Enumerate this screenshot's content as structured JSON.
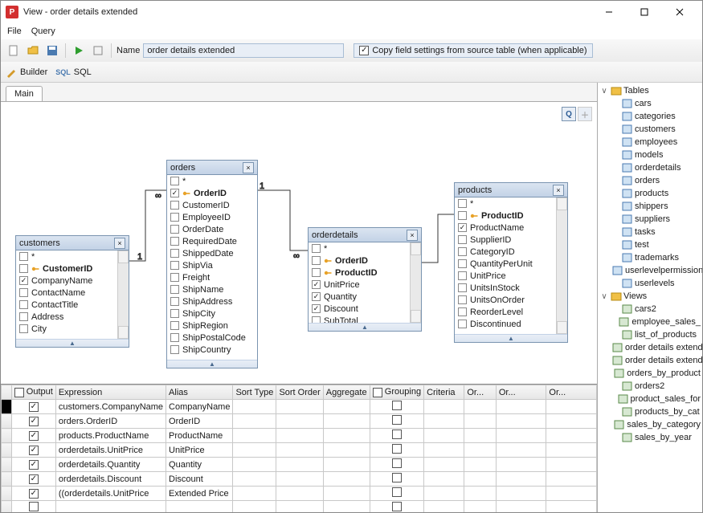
{
  "window": {
    "title": "View - order details extended"
  },
  "menu": {
    "file": "File",
    "query": "Query"
  },
  "toolbar": {
    "name_label": "Name",
    "name_value": "order details extended",
    "copy_label": "Copy field settings from source table (when applicable)"
  },
  "modes": {
    "builder": "Builder",
    "sql": "SQL"
  },
  "tab": {
    "main": "Main"
  },
  "canvas": {
    "customers": {
      "title": "customers",
      "fields": [
        {
          "n": "*",
          "c": false,
          "k": false,
          "b": false
        },
        {
          "n": "CustomerID",
          "c": false,
          "k": true,
          "b": true
        },
        {
          "n": "CompanyName",
          "c": true,
          "k": false,
          "b": false
        },
        {
          "n": "ContactName",
          "c": false,
          "k": false,
          "b": false
        },
        {
          "n": "ContactTitle",
          "c": false,
          "k": false,
          "b": false
        },
        {
          "n": "Address",
          "c": false,
          "k": false,
          "b": false
        },
        {
          "n": "City",
          "c": false,
          "k": false,
          "b": false
        }
      ]
    },
    "orders": {
      "title": "orders",
      "fields": [
        {
          "n": "*",
          "c": false,
          "k": false,
          "b": false
        },
        {
          "n": "OrderID",
          "c": true,
          "k": true,
          "b": true
        },
        {
          "n": "CustomerID",
          "c": false,
          "k": false,
          "b": false
        },
        {
          "n": "EmployeeID",
          "c": false,
          "k": false,
          "b": false
        },
        {
          "n": "OrderDate",
          "c": false,
          "k": false,
          "b": false
        },
        {
          "n": "RequiredDate",
          "c": false,
          "k": false,
          "b": false
        },
        {
          "n": "ShippedDate",
          "c": false,
          "k": false,
          "b": false
        },
        {
          "n": "ShipVia",
          "c": false,
          "k": false,
          "b": false
        },
        {
          "n": "Freight",
          "c": false,
          "k": false,
          "b": false
        },
        {
          "n": "ShipName",
          "c": false,
          "k": false,
          "b": false
        },
        {
          "n": "ShipAddress",
          "c": false,
          "k": false,
          "b": false
        },
        {
          "n": "ShipCity",
          "c": false,
          "k": false,
          "b": false
        },
        {
          "n": "ShipRegion",
          "c": false,
          "k": false,
          "b": false
        },
        {
          "n": "ShipPostalCode",
          "c": false,
          "k": false,
          "b": false
        },
        {
          "n": "ShipCountry",
          "c": false,
          "k": false,
          "b": false
        }
      ]
    },
    "orderdetails": {
      "title": "orderdetails",
      "fields": [
        {
          "n": "*",
          "c": false,
          "k": false,
          "b": false
        },
        {
          "n": "OrderID",
          "c": false,
          "k": true,
          "b": true
        },
        {
          "n": "ProductID",
          "c": false,
          "k": true,
          "b": true
        },
        {
          "n": "UnitPrice",
          "c": true,
          "k": false,
          "b": false
        },
        {
          "n": "Quantity",
          "c": true,
          "k": false,
          "b": false
        },
        {
          "n": "Discount",
          "c": true,
          "k": false,
          "b": false
        },
        {
          "n": "SubTotal",
          "c": false,
          "k": false,
          "b": false
        }
      ]
    },
    "products": {
      "title": "products",
      "fields": [
        {
          "n": "*",
          "c": false,
          "k": false,
          "b": false
        },
        {
          "n": "ProductID",
          "c": false,
          "k": true,
          "b": true
        },
        {
          "n": "ProductName",
          "c": true,
          "k": false,
          "b": false
        },
        {
          "n": "SupplierID",
          "c": false,
          "k": false,
          "b": false
        },
        {
          "n": "CategoryID",
          "c": false,
          "k": false,
          "b": false
        },
        {
          "n": "QuantityPerUnit",
          "c": false,
          "k": false,
          "b": false
        },
        {
          "n": "UnitPrice",
          "c": false,
          "k": false,
          "b": false
        },
        {
          "n": "UnitsInStock",
          "c": false,
          "k": false,
          "b": false
        },
        {
          "n": "UnitsOnOrder",
          "c": false,
          "k": false,
          "b": false
        },
        {
          "n": "ReorderLevel",
          "c": false,
          "k": false,
          "b": false
        },
        {
          "n": "Discontinued",
          "c": false,
          "k": false,
          "b": false
        }
      ]
    }
  },
  "grid": {
    "headers": [
      "Output",
      "Expression",
      "Alias",
      "Sort Type",
      "Sort Order",
      "Aggregate",
      "Grouping",
      "Criteria",
      "Or...",
      "Or...",
      "Or..."
    ],
    "rows": [
      {
        "out": true,
        "expr": "customers.CompanyName",
        "alias": "CompanyName",
        "grp": false
      },
      {
        "out": true,
        "expr": "orders.OrderID",
        "alias": "OrderID",
        "grp": false
      },
      {
        "out": true,
        "expr": "products.ProductName",
        "alias": "ProductName",
        "grp": false
      },
      {
        "out": true,
        "expr": "orderdetails.UnitPrice",
        "alias": "UnitPrice",
        "grp": false
      },
      {
        "out": true,
        "expr": "orderdetails.Quantity",
        "alias": "Quantity",
        "grp": false
      },
      {
        "out": true,
        "expr": "orderdetails.Discount",
        "alias": "Discount",
        "grp": false
      },
      {
        "out": true,
        "expr": "((orderdetails.UnitPrice",
        "alias": "Extended Price",
        "grp": false
      },
      {
        "out": false,
        "expr": "",
        "alias": "",
        "grp": false
      }
    ]
  },
  "tree": {
    "tables": {
      "label": "Tables",
      "items": [
        "cars",
        "categories",
        "customers",
        "employees",
        "models",
        "orderdetails",
        "orders",
        "products",
        "shippers",
        "suppliers",
        "tasks",
        "test",
        "trademarks",
        "userlevelpermissions",
        "userlevels"
      ]
    },
    "views": {
      "label": "Views",
      "items": [
        "cars2",
        "employee_sales_",
        "list_of_products",
        "order details extended",
        "order details extended",
        "orders_by_product",
        "orders2",
        "product_sales_for",
        "products_by_cat",
        "sales_by_category",
        "sales_by_year"
      ]
    }
  }
}
